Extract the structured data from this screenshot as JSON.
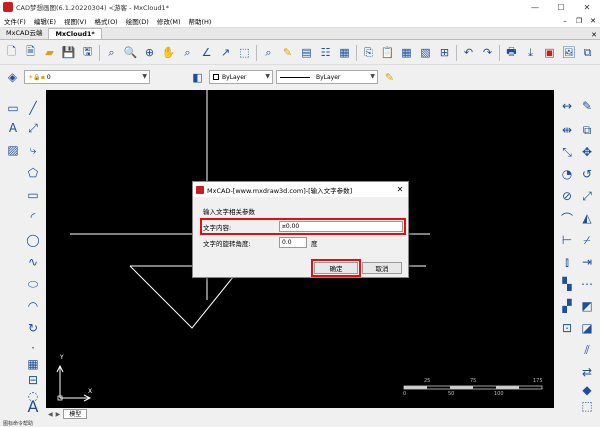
{
  "window": {
    "title": "CAD梦想画图(6.1.20220304) <游客 - MxCloud1*"
  },
  "menu": [
    "文件(F)",
    "编辑(E)",
    "视图(V)",
    "格式(O)",
    "绘图(D)",
    "修改(M)",
    "帮助(H)"
  ],
  "doc_tabs": [
    "MxCAD云端",
    "MxCloud1*"
  ],
  "layers": {
    "current_layer": "0",
    "color": "ByLayer",
    "linetype": "ByLayer"
  },
  "dialog": {
    "title": "MxCAD-[www.mxdraw3d.com]-[输入文字参数]",
    "section": "输入文字相关参数",
    "content_label": "文字内容:",
    "content_value": "¤0.00",
    "angle_label": "文字的旋转角度:",
    "angle_value": "0.0",
    "angle_unit": "度",
    "ok_label": "确定",
    "cancel_label": "取消"
  },
  "canvas": {
    "scale_labels": [
      "25",
      "75",
      "175",
      "0",
      "50",
      "100"
    ],
    "y_axis": "Y",
    "x_axis": "X"
  },
  "model_tab": "模型",
  "status": "图标命令帮助"
}
